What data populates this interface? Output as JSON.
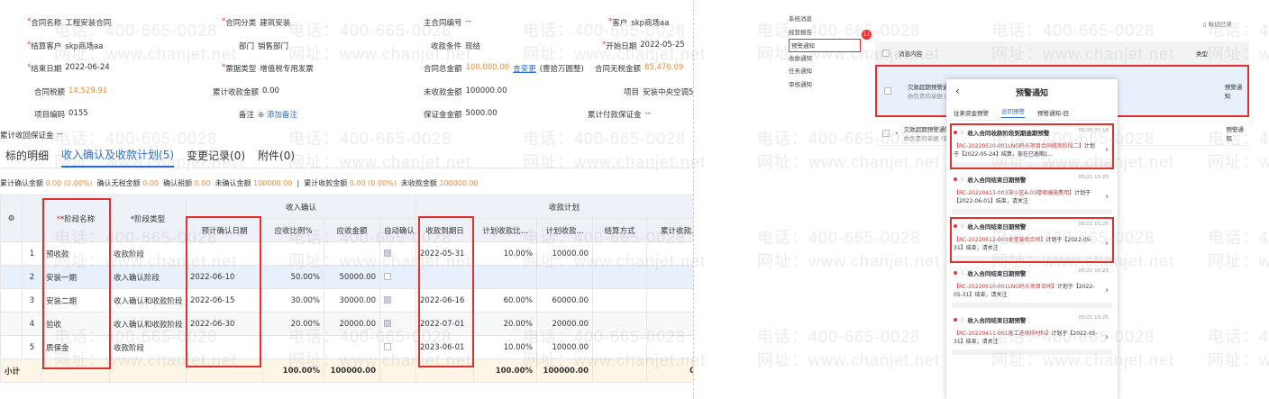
{
  "fields": {
    "contract_name": {
      "label": "合同名称",
      "value": "工程安装合同"
    },
    "contract_category": {
      "label": "合同分类",
      "value": "建筑安装"
    },
    "main_contract_no": {
      "label": "主合同编号",
      "value": "--"
    },
    "customer": {
      "label": "客户",
      "value": "skp商场aa"
    },
    "settle_customer": {
      "label": "结算客户",
      "value": "skp商场aa"
    },
    "department": {
      "label": "部门",
      "value": "销售部门"
    },
    "payment_terms": {
      "label": "收款条件",
      "value": "现结"
    },
    "start_date": {
      "label": "开始日期",
      "value": "2022-05-25"
    },
    "end_date": {
      "label": "结束日期",
      "value": "2022-06-24"
    },
    "invoice_type": {
      "label": "票据类型",
      "value": "增值税专用发票"
    },
    "total_amount": {
      "label": "合同总金额",
      "value": "100,000.00",
      "link": "查变更",
      "extra": "(壹拾万圆整)"
    },
    "total_no_tax": {
      "label": "合同无税金额",
      "value": "85,470.09"
    },
    "tax_amount": {
      "label": "合同税额",
      "value": "14,529.91"
    },
    "received_total": {
      "label": "累计收款金额",
      "value": "0.00"
    },
    "unreceived": {
      "label": "未收款金额",
      "value": "100000.00"
    },
    "project": {
      "label": "项目",
      "value": "安装中央空调5月"
    },
    "project_code": {
      "label": "项目编码",
      "value": "0155"
    },
    "remark": {
      "label": "备注",
      "value": "添加备注"
    },
    "deposit": {
      "label": "保证金金额",
      "value": "5000.00"
    },
    "paid_deposit": {
      "label": "累计付款保证金",
      "value": "--"
    },
    "received_deposit": {
      "label": "累计收回保证金",
      "value": "--"
    }
  },
  "tabs": [
    {
      "label": "标的明细"
    },
    {
      "label": "收入确认及收款计划(5)"
    },
    {
      "label": "变更记录(0)"
    },
    {
      "label": "附件(0)"
    }
  ],
  "summary": {
    "confirmed_label": "累计确认金额",
    "confirmed_value": "0.00 (0.00%)",
    "confirmed_no_tax_label": "确认无税金额",
    "confirmed_no_tax_value": "0.00",
    "confirmed_tax_label": "确认税额",
    "confirmed_tax_value": "0.00",
    "unconfirmed_label": "未确认金额",
    "unconfirmed_value": "100000.00",
    "received_label": "累计收款金额",
    "received_value": "0.00 (0.00%)",
    "unreceived_label": "未收款金额",
    "unreceived_value": "100000.00"
  },
  "table": {
    "group_income": "收入确认",
    "group_plan": "收款计划",
    "headers": [
      "*阶段名称",
      "*阶段类型",
      "预计确认日期",
      "应收比例%",
      "应收金额",
      "自动确认",
      "收款到期日",
      "计划收款比...",
      "计划收款...",
      "结算方式",
      "累计收款..."
    ],
    "rows": [
      {
        "no": "1",
        "name": "预收款",
        "type": "收款阶段",
        "date": "",
        "ratio": "",
        "amount": "",
        "due": "2022-05-31",
        "plan_ratio": "10.00%",
        "plan_amount": "10000.00"
      },
      {
        "no": "2",
        "name": "安装一期",
        "type": "收入确认阶段",
        "date": "2022-06-10",
        "ratio": "50.00%",
        "amount": "50000.00",
        "due": "",
        "plan_ratio": "",
        "plan_amount": ""
      },
      {
        "no": "3",
        "name": "安装二期",
        "type": "收入确认和收款阶段",
        "date": "2022-06-15",
        "ratio": "30.00%",
        "amount": "30000.00",
        "due": "2022-06-16",
        "plan_ratio": "60.00%",
        "plan_amount": "60000.00"
      },
      {
        "no": "4",
        "name": "验收",
        "type": "收入确认和收款阶段",
        "date": "2022-06-30",
        "ratio": "20.00%",
        "amount": "20000.00",
        "due": "2022-07-01",
        "plan_ratio": "20.00%",
        "plan_amount": "20000.00"
      },
      {
        "no": "5",
        "name": "质保金",
        "type": "收款阶段",
        "date": "",
        "ratio": "",
        "amount": "",
        "due": "2023-06-01",
        "plan_ratio": "10.00%",
        "plan_amount": "10000.00"
      }
    ],
    "total": {
      "label": "小计",
      "ratio": "100.00%",
      "amount": "100000.00",
      "plan_ratio": "100.00%",
      "plan_amount": "100000.00",
      "received": "0.00"
    }
  },
  "right": {
    "sidebar": [
      "系统消息",
      "经营报告",
      "预警通知",
      "收款通知",
      "任务通知",
      "审核通知"
    ],
    "badge": "11",
    "top_right": "标记已读",
    "list_headers": {
      "content": "消息内容",
      "type": "类型"
    },
    "list_rows": [
      {
        "title": "欠款超期预警通知",
        "sub": "你负责的单据 (销售...",
        "type": "预警通知"
      },
      {
        "title": "欠款超期预警通知",
        "sub": "你负责的单据 (销售...",
        "type": "预警通知"
      }
    ]
  },
  "phone": {
    "title": "预警通知",
    "tabs": [
      "往来资金预警",
      "合同预警",
      "预警通知-旧"
    ],
    "cards": [
      {
        "title": "收入合同收款阶段到期逾期预警",
        "time": "05/20 07:18",
        "code": "【RC-20220510-001LNG码头项目合同磋商阶段二】",
        "text": "计划于【2022-05-24】结算，现在已逾期1..."
      },
      {
        "title": "收入合同结束日期预警",
        "time": "05/21 15:25",
        "code": "【RC-20220413-003深小区A-03楼修缮施费用】",
        "text": "计划于【2022-06-01】结束，请关注"
      },
      {
        "title": "收入合同结束日期预警",
        "time": "05/21 15:25",
        "code": "【RC-20220512-003食堂装修合同】",
        "text": "计划于【2022-05-31】结束，请关注"
      },
      {
        "title": "收入合同结束日期预警",
        "time": "05/21 15:25",
        "code": "【RC-20220510-001LNG码头项目合同】",
        "text": "计划于【2022-05-31】结束，请关注"
      },
      {
        "title": "收入合同结束日期预警",
        "time": "05/21 15:25",
        "code": "【RC-20220411-001施工进场样材料】",
        "text": "计划于【2022-05-31】结束，请关注"
      }
    ]
  },
  "watermark": {
    "phone": "电话：400-665-0028",
    "site": "网址：www.chanjet.net"
  }
}
